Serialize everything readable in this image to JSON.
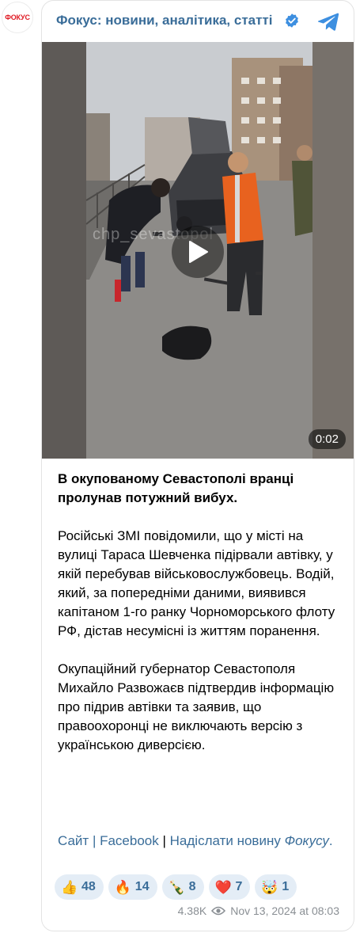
{
  "channel": {
    "avatar_text": "ФОКУС",
    "title": "Фокус: новини, аналітика, статті",
    "verified_icon": "verified-badge-icon",
    "telegram_icon": "telegram-icon"
  },
  "video": {
    "duration": "0:02",
    "watermark": "chp_sevastopol",
    "play_icon": "play-icon"
  },
  "post": {
    "headline": "В окупованому Севастополі вранці пролунав потужний вибух.",
    "paragraphs": [
      "Російські ЗМІ повідомили, що у місті на вулиці Тараса Шевченка підірвали автівку, у якій перебував військовослужбовець. Водій, який, за попередніми даними, виявився капітаном 1-го ранку Чорноморського флоту РФ, дістав несумісні із життям поранення.",
      "Окупаційний губернатор Севастополя Михайло Развожаєв підтвердив інформацію про підрив автівки та заявив, що правоохоронці не виключають версію з українською диверсією."
    ]
  },
  "links": {
    "site": "Сайт",
    "separator1": " | ",
    "facebook": "Facebook",
    "separator2": " | ",
    "send_news": "Надіслати новину",
    "focus": "Фокусу",
    "period": "."
  },
  "reactions": [
    {
      "emoji": "👍",
      "name": "thumbs-up",
      "count": "48"
    },
    {
      "emoji": "🔥",
      "name": "fire",
      "count": "14"
    },
    {
      "emoji": "🍾",
      "name": "champagne",
      "count": "8"
    },
    {
      "emoji": "❤️",
      "name": "heart",
      "count": "7"
    },
    {
      "emoji": "🤯",
      "name": "exploding-head",
      "count": "1"
    }
  ],
  "meta": {
    "views": "4.38K",
    "views_icon": "eye-icon",
    "timestamp": "Nov 13, 2024 at 08:03"
  },
  "colors": {
    "accent": "#3a6d99",
    "reaction_bg": "#e4edf6",
    "brand_red": "#e01b24",
    "verified": "#3d8fe0"
  }
}
